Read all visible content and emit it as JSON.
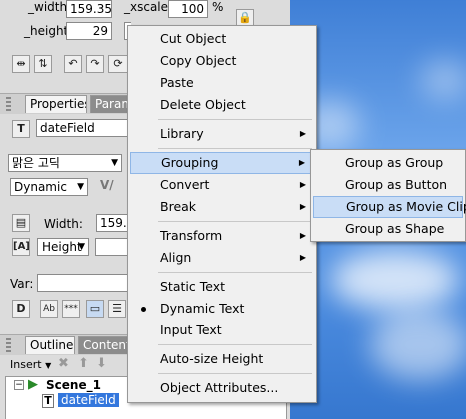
{
  "transform": {
    "width_label": "_width:",
    "width_value": "159.35",
    "xscale_label": "_xscale:",
    "xscale_value": "100",
    "xscale_unit": "%",
    "height_label": "_height:",
    "height_value": "29"
  },
  "properties_panel": {
    "tabs": [
      {
        "label": "Properties",
        "active": true
      },
      {
        "label": "Parameters",
        "active": false
      }
    ],
    "instance_name": "dateField",
    "font_name": "맑은 고딕",
    "text_type": "Dynamic",
    "width_label": "Width:",
    "width_value": "159.",
    "height_dropdown": "Height",
    "var_label": "Var:",
    "ab_label": "Ab",
    "stars_label": "***"
  },
  "outline_panel": {
    "tabs": [
      {
        "label": "Outline",
        "active": true
      },
      {
        "label": "Contents",
        "active": false
      }
    ],
    "insert_label": "Insert",
    "tree": [
      {
        "label": "Scene_1",
        "level": 0
      },
      {
        "label": "dateField",
        "level": 1,
        "selected": true
      }
    ]
  },
  "context_menu": {
    "items": [
      {
        "label": "Cut Object"
      },
      {
        "label": "Copy Object"
      },
      {
        "label": "Paste"
      },
      {
        "label": "Delete Object"
      },
      {
        "label": "Library",
        "submenu": true
      },
      {
        "label": "Grouping",
        "submenu": true,
        "highlighted": true
      },
      {
        "label": "Convert",
        "submenu": true
      },
      {
        "label": "Break",
        "submenu": true
      },
      {
        "label": "Transform",
        "submenu": true
      },
      {
        "label": "Align",
        "submenu": true
      },
      {
        "label": "Static Text"
      },
      {
        "label": "Dynamic Text",
        "checked": true
      },
      {
        "label": "Input Text"
      },
      {
        "label": "Auto-size Height"
      },
      {
        "label": "Object Attributes..."
      }
    ]
  },
  "grouping_submenu": {
    "items": [
      {
        "label": "Group as Group"
      },
      {
        "label": "Group as Button"
      },
      {
        "label": "Group as Movie Clip",
        "highlighted": true
      },
      {
        "label": "Group as Shape"
      }
    ]
  },
  "colors": {
    "highlight": "#c9ddf6",
    "highlight_border": "#8fb6e6",
    "desktop_blue": "#4d8de0",
    "selection_blue": "#3377dd"
  }
}
